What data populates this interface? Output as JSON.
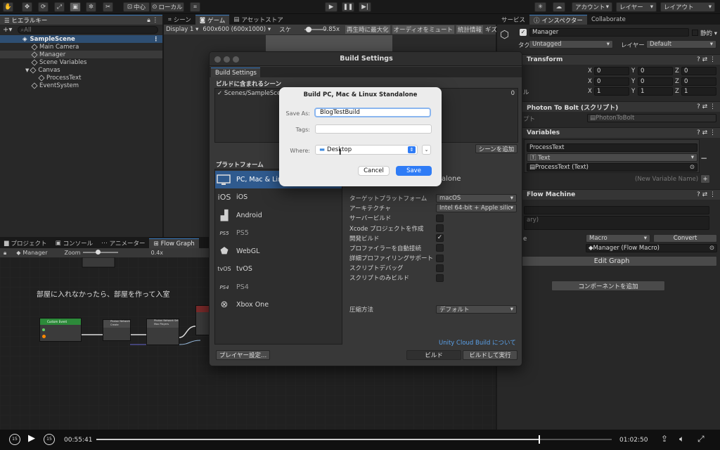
{
  "toolbar": {
    "pivot": "中心",
    "space": "ローカル",
    "account": "アカウント",
    "layers": "レイヤー",
    "layout": "レイアウト"
  },
  "hierarchy": {
    "tab": "ヒエラルキー",
    "search_placeholder": "All",
    "scene": "SampleScene",
    "items": [
      "Main Camera",
      "Manager",
      "Scene Variables",
      "Canvas",
      "ProcessText",
      "EventSystem"
    ]
  },
  "scene_view": {
    "tabs": [
      "シーン",
      "ゲーム",
      "アセットストア"
    ],
    "display": "Display 1",
    "resolution": "600x600 (600x1000)",
    "scale_label": "スケ",
    "scale_value": "0.85x",
    "maximize": "再生時に最大化",
    "mute": "オーディオをミュート",
    "stats": "統計情報",
    "gizmos": "ギズモ"
  },
  "bottom": {
    "tabs": [
      "プロジェクト",
      "コンソール",
      "アニメーター",
      "Flow Graph"
    ],
    "object": "Manager",
    "zoom_label": "Zoom",
    "zoom_value": "0.4x",
    "comment": "部屋に入れなかったら、部屋を作って入室",
    "nodes": [
      "Custom Event",
      "Photon Network Create",
      "Photon Network Set Max Players"
    ]
  },
  "inspector": {
    "tabs": [
      "サービス",
      "インスペクター",
      "Collaborate"
    ],
    "object_name": "Manager",
    "static_label": "静的",
    "tag_label": "タグ",
    "tag_value": "Untagged",
    "layer_label": "レイヤー",
    "layer_value": "Default",
    "transform": {
      "title": "Transform",
      "rows": [
        [
          "0",
          "0",
          "0"
        ],
        [
          "0",
          "0",
          "0"
        ],
        [
          "1",
          "1",
          "1"
        ]
      ],
      "scale_suffix": "ル"
    },
    "script_comp": {
      "title": "Photon To Bolt (スクリプト)",
      "label": "プト",
      "value": "PhotonToBolt"
    },
    "variables": {
      "title": "Variables",
      "name": "ProcessText",
      "type": "Text",
      "value": "ProcessText (Text)",
      "new_placeholder": "(New Variable Name)"
    },
    "flow": {
      "title": "Flow Machine",
      "summary_hint": "ary)",
      "source_label": "e",
      "source": "Macro",
      "convert": "Convert",
      "macro": "Manager (Flow Macro)",
      "edit": "Edit Graph"
    },
    "add_component": "コンポーネントを追加"
  },
  "build": {
    "title": "Build Settings",
    "tab": "Build Settings",
    "scenes_label": "ビルドに含まれるシーン",
    "scene_item": "Scenes/SampleScene",
    "scene_index": "0",
    "add_open": "シーンを追加",
    "platform_label": "プラットフォーム",
    "platforms": [
      {
        "name": "PC, Mac & Linux Standalone",
        "icon": "monitor-icon"
      },
      {
        "name": "iOS",
        "icon": "ios-icon"
      },
      {
        "name": "Android",
        "icon": "android-icon"
      },
      {
        "name": "PS5",
        "icon": "ps5-icon"
      },
      {
        "name": "WebGL",
        "icon": "html5-icon"
      },
      {
        "name": "tvOS",
        "icon": "tvos-icon"
      },
      {
        "name": "PS4",
        "icon": "ps4-icon"
      },
      {
        "name": "Xbox One",
        "icon": "xbox-icon"
      }
    ],
    "right_partial": "alone",
    "settings": [
      {
        "label": "ターゲットプラットフォーム",
        "value": "macOS"
      },
      {
        "label": "アーキテクチャ",
        "value": "Intel 64-bit + Apple silicon"
      },
      {
        "label": "サーバービルド"
      },
      {
        "label": "Xcode プロジェクトを作成"
      },
      {
        "label": "開発ビルド",
        "checked": true
      },
      {
        "label": "プロファイラーを自動接続"
      },
      {
        "label": "詳細プロファイリングサポート"
      },
      {
        "label": "スクリプトデバッグ"
      },
      {
        "label": "スクリプトのみビルド"
      }
    ],
    "compression_label": "圧縮方法",
    "compression_value": "デフォルト",
    "cloud_link": "Unity Cloud Build について",
    "player_settings": "プレイヤー設定...",
    "build_btn": "ビルド",
    "build_run_btn": "ビルドして実行"
  },
  "dialog": {
    "title": "Build PC, Mac & Linux Standalone",
    "save_as_label": "Save As:",
    "save_as_value": "BlogTestBuild",
    "tags_label": "Tags:",
    "where_label": "Where:",
    "where_value": "Desktop",
    "cancel": "Cancel",
    "save": "Save"
  },
  "video": {
    "current": "00:55:41",
    "total": "01:02:50",
    "skip": "15",
    "progress": 0.86
  }
}
